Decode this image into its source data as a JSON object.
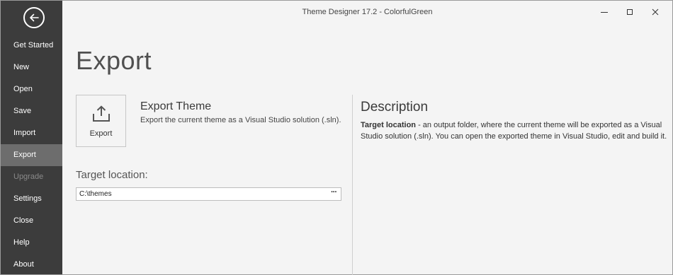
{
  "window": {
    "title": "Theme Designer 17.2 - ColorfulGreen"
  },
  "sidebar": {
    "items": [
      {
        "label": "Get Started"
      },
      {
        "label": "New"
      },
      {
        "label": "Open"
      },
      {
        "label": "Save"
      },
      {
        "label": "Import"
      },
      {
        "label": "Export"
      },
      {
        "label": "Upgrade"
      },
      {
        "label": "Settings"
      },
      {
        "label": "Close"
      },
      {
        "label": "Help"
      },
      {
        "label": "About"
      }
    ],
    "active": "Export",
    "disabled": "Upgrade"
  },
  "main": {
    "page_title": "Export",
    "export_tile": {
      "label": "Export",
      "icon": "upload-icon"
    },
    "export_heading": "Export Theme",
    "export_description": "Export the current theme as a Visual Studio solution (.sln).",
    "target_label": "Target location:",
    "target_value": "C:\\themes",
    "browse_label": "···"
  },
  "description": {
    "heading": "Description",
    "term": "Target location",
    "text": " - an output folder, where the current theme will be exported as a Visual Studio solution (.sln). You can open the exported theme in Visual Studio, edit and build it."
  },
  "colors": {
    "sidebar_bg": "#3c3c3c",
    "sidebar_active": "#6d6d6d",
    "content_bg": "#f4f4f4"
  }
}
